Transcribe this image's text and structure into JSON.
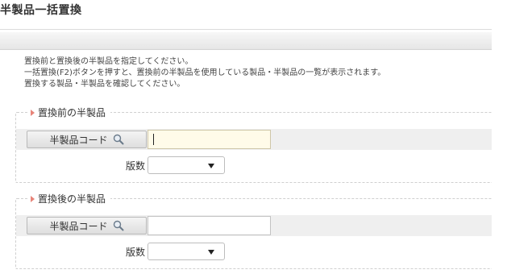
{
  "page": {
    "title": "半製品一括置換"
  },
  "instructions": [
    "置換前と置換後の半製品を指定してください。",
    "一括置換(F2)ボタンを押すと、置換前の半製品を使用している製品・半製品の一覧が表示されます。",
    "置換する製品・半製品を確認してください。"
  ],
  "before": {
    "legend": "置換前の半製品",
    "code_label": "半製品コード",
    "code_value": "",
    "version_label": "版数",
    "version_selected": ""
  },
  "after": {
    "legend": "置換後の半製品",
    "code_label": "半製品コード",
    "code_value": "",
    "version_label": "版数",
    "version_selected": ""
  },
  "icons": {
    "search": "search-icon",
    "legend_marker": "triangle-right-icon",
    "dropdown": "chevron-down-icon"
  },
  "colors": {
    "focused_input": "#fffbe9",
    "legend_marker": "#e8857a",
    "row_band": "#efefef"
  }
}
